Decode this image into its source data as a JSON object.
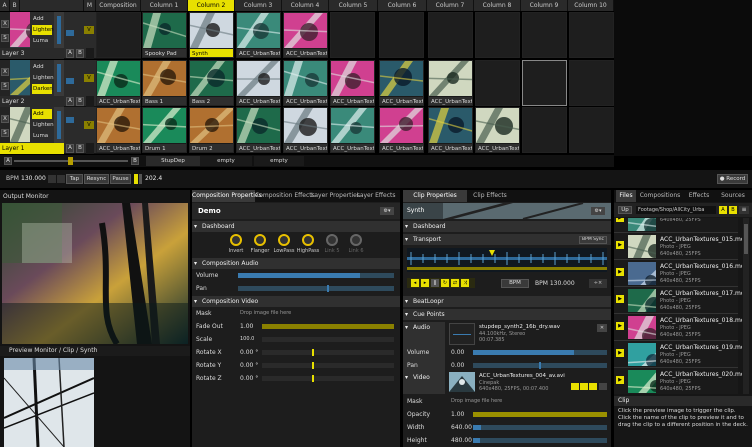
{
  "header": {
    "a_label": "A",
    "b_label": "B",
    "m_label": "M",
    "composition_label": "Composition",
    "columns": [
      "Column 1",
      "Column 2",
      "Column 3",
      "Column 4",
      "Column 5",
      "Column 6",
      "Column 7",
      "Column 8",
      "Column 9",
      "Column 10"
    ],
    "selected_column": 1
  },
  "layers": [
    {
      "name": "Layer 3",
      "blend_modes": [
        "Add",
        "Lighten",
        "Luma Key"
      ],
      "selected_blend": 1,
      "x": "X",
      "s": "S",
      "a": "A",
      "b": "B",
      "v": "V",
      "comp_label": "",
      "clips": [
        "Spooky Pad",
        "Synth",
        "ACC_UrbanTextures",
        "ACC_UrbanTextures",
        "",
        "",
        "",
        "",
        "",
        ""
      ]
    },
    {
      "name": "Layer 2",
      "blend_modes": [
        "Add",
        "Lighten",
        "Darken"
      ],
      "selected_blend": 2,
      "x": "X",
      "s": "S",
      "a": "A",
      "b": "B",
      "v": "V",
      "comp_label": "ACC_UrbanTextures",
      "clips": [
        "Bass 1",
        "Bass 2",
        "ACC_UrbanTextures",
        "ACC_UrbanTextures",
        "ACC_UrbanTextures",
        "ACC_UrbanTextures",
        "ACC_UrbanTextures",
        "",
        "",
        ""
      ]
    },
    {
      "name": "Layer 1",
      "blend_modes": [
        "Add",
        "Lighten",
        "Luma Key"
      ],
      "selected_blend": 0,
      "x": "X",
      "s": "S",
      "a": "A",
      "b": "B",
      "v": "V",
      "comp_label": "ACC_UrbanTextures",
      "clips": [
        "Drum 1",
        "Drum 2",
        "ACC_UrbanTextures",
        "ACC_UrbanTextures",
        "ACC_UrbanTextures",
        "ACC_UrbanTextures",
        "ACC_UrbanTextures",
        "ACC_UrbanTextures",
        "",
        ""
      ]
    }
  ],
  "crossfader": {
    "a": "A",
    "b": "B",
    "decks": [
      "StupDep",
      "empty",
      "empty"
    ]
  },
  "transport": {
    "bpm_label": "BPM",
    "bpm_value": "130.000",
    "tap": "Tap",
    "resync": "Resync",
    "pause": "Pause",
    "count": "202.4",
    "record": "Record"
  },
  "output_monitor": {
    "title": "Output Monitor",
    "preview_title": "Preview Monitor / Clip / Synth"
  },
  "composition": {
    "tabs": [
      "Composition Properties",
      "Composition Effects",
      "Layer Properties",
      "Layer Effects"
    ],
    "name": "Demo",
    "dashboard_label": "Dashboard",
    "knobs": [
      "Invert",
      "Flanger",
      "LowPass",
      "HighPass",
      "Link 5",
      "Link 6"
    ],
    "audio_label": "Composition Audio",
    "volume_label": "Volume",
    "volume_value": "",
    "pan_label": "Pan",
    "pan_value": "",
    "video_label": "Composition Video",
    "mask_label": "Mask",
    "mask_hint": "Drop image file here",
    "params": [
      {
        "label": "Fade Out",
        "value": "1.00"
      },
      {
        "label": "Scale",
        "value": "100.0"
      },
      {
        "label": "Rotate X",
        "value": "0.00 °"
      },
      {
        "label": "Rotate Y",
        "value": "0.00 °"
      },
      {
        "label": "Rotate Z",
        "value": "0.00 °"
      }
    ]
  },
  "clip_props": {
    "tabs": [
      "Clip Properties",
      "Clip Effects"
    ],
    "name": "Synth",
    "dashboard_label": "Dashboard",
    "transport_label": "Transport",
    "bpm_sync": "BPM Sync",
    "bpm_mode": "BPM",
    "bpm_value": "BPM 130.000",
    "beatloopr": "BeatLoopr",
    "cue_points": "Cue Points",
    "audio_label": "Audio",
    "audio_file": "stupdep_synth2_16b_dry.wav",
    "audio_meta1": "44.100kHz, Stereo",
    "audio_meta2": "00:07.385",
    "volume_label": "Volume",
    "volume_value": "0.00",
    "pan_label": "Pan",
    "pan_value": "0.00",
    "video_label": "Video",
    "video_file": "ACC_UrbanTextures_004_av.avi",
    "video_codec": "Cinepak",
    "video_meta": "640x480, 25FPS, 00:07.400",
    "mask_label": "Mask",
    "mask_hint": "Drop image file here",
    "opacity_label": "Opacity",
    "opacity_value": "1.00",
    "width_label": "Width",
    "width_value": "640.00",
    "height_label": "Height",
    "height_value": "480.00"
  },
  "browser": {
    "tabs": [
      "Files",
      "Compositions",
      "Effects",
      "Sources"
    ],
    "up_label": "Up",
    "path": "Footage/Shop/AllCity_Urba",
    "files": [
      {
        "name": "",
        "meta": "640x480, 25FPS"
      },
      {
        "name": "ACC_UrbanTextures_015.mov",
        "meta": "Photo - JPEG\n640x480, 25FPS"
      },
      {
        "name": "ACC_UrbanTextures_016.mov",
        "meta": "Photo - JPEG\n640x480, 25FPS"
      },
      {
        "name": "ACC_UrbanTextures_017.mov",
        "meta": "Photo - JPEG\n640x480, 25FPS"
      },
      {
        "name": "ACC_UrbanTextures_018.mov",
        "meta": "Photo - JPEG\n640x480, 25FPS"
      },
      {
        "name": "ACC_UrbanTextures_019.mov",
        "meta": "Photo - JPEG\n640x480, 25FPS"
      },
      {
        "name": "ACC_UrbanTextures_020.mov",
        "meta": "Photo - JPEG\n640x480, 25FPS"
      }
    ],
    "help_title": "Clip",
    "help_text": "Click the preview image to trigger the clip. Click the name of the clip to preview it and to drag the clip to a different position in the deck."
  },
  "colors": {
    "accent": "#e8e000",
    "panel": "#1d1d1d",
    "header": "#303030"
  }
}
